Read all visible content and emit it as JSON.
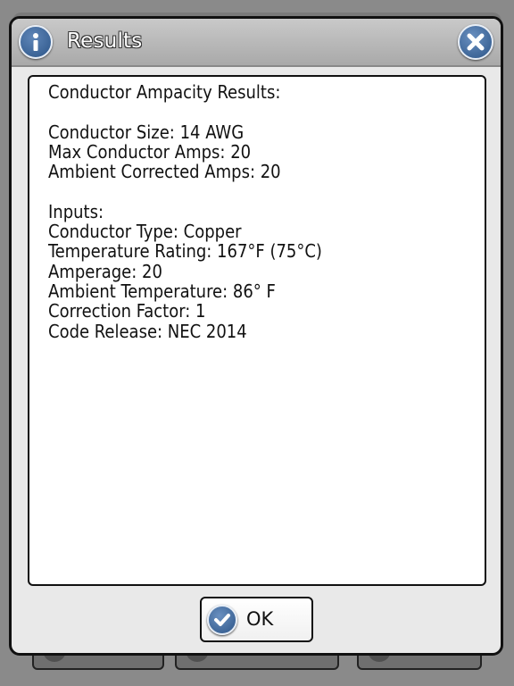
{
  "dialog": {
    "title": "Results",
    "ok_label": "OK"
  },
  "results": {
    "heading": "Conductor Ampacity Results:",
    "outputs": [
      "Conductor Size: 14 AWG",
      "Max Conductor Amps: 20",
      "Ambient Corrected Amps: 20"
    ],
    "inputs_heading": "Inputs:",
    "inputs": [
      "Conductor Type: Copper",
      "Temperature Rating: 167°F (75°C)",
      "Amperage: 20",
      "Ambient Temperature: 86° F",
      "Correction Factor: 1",
      "Code Release: NEC 2014"
    ]
  },
  "icons": {
    "title_icon": "info-icon",
    "close_icon": "close-icon",
    "ok_icon": "checkmark-icon"
  },
  "colors": {
    "icon_blue": "#2c5588",
    "titlebar_gray": "#b5b5b5",
    "dialog_bg": "#e9e9e9"
  }
}
